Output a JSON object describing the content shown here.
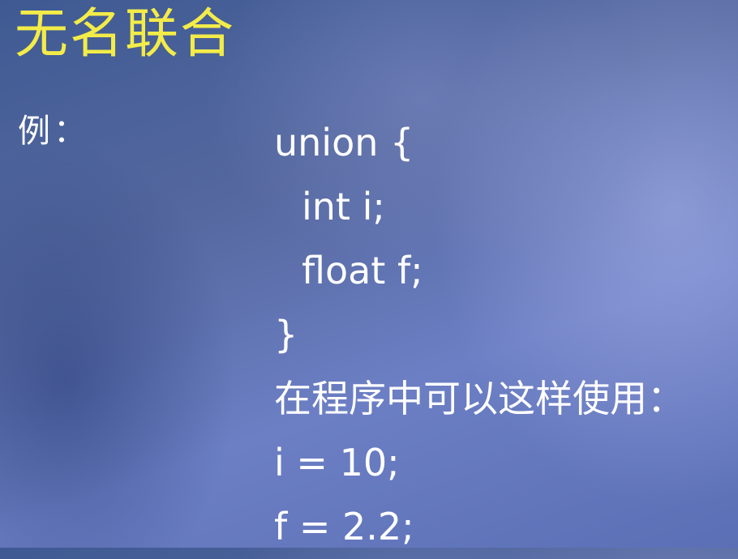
{
  "slide": {
    "title": "无名联合",
    "example_label": "例：",
    "lines": [
      "union {",
      "int i;",
      "float f;",
      "}",
      "在程序中可以这样使用：",
      "i = 10;",
      "f = 2.2;"
    ]
  },
  "colors": {
    "title": "#f3ec48",
    "text": "#ffffff",
    "background": "#5b6fb6"
  }
}
